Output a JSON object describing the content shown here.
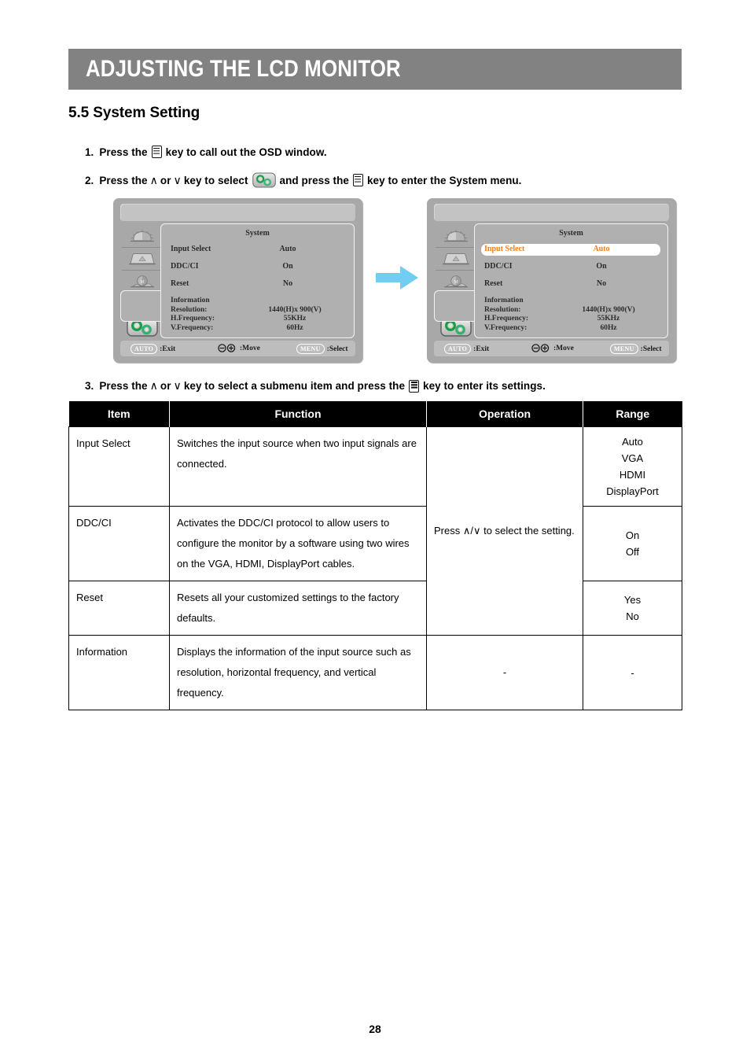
{
  "header": {
    "chapter_title": "ADJUSTING THE LCD MONITOR"
  },
  "section": {
    "heading": "5.5 System Setting"
  },
  "steps": [
    {
      "number": "1.",
      "text_before": "Press the",
      "icon": "menu-key-icon",
      "text_after": "key to call out the OSD window."
    },
    {
      "number": "2.",
      "part_a": "Press the",
      "up_glyph": "∧",
      "or_text": "or",
      "down_glyph": "∨",
      "part_b": "key to select",
      "icon": "system-gear-icon",
      "part_c": "and press the",
      "icon2": "menu-key-icon",
      "part_d": "key to enter the System menu."
    },
    {
      "number": "3.",
      "part_a": "Press the",
      "up_glyph": "∧",
      "or_text": "or",
      "down_glyph": "∨",
      "part_b": "key to select a submenu item and press the",
      "icon": "menu-key-icon",
      "part_c": "key to enter its settings."
    }
  ],
  "osd": {
    "menu_title": "System",
    "rail_icons": [
      "brightness-icon",
      "image-icon",
      "color-icon",
      "osd-icon",
      "system-gear-icon"
    ],
    "rows": [
      {
        "label": "Input Select",
        "value": "Auto"
      },
      {
        "label": "DDC/CI",
        "value": "On"
      },
      {
        "label": "Reset",
        "value": "No"
      }
    ],
    "information": {
      "title": "Information",
      "lines": [
        {
          "key": "Resolution:",
          "value": "1440(H)x 900(V)"
        },
        {
          "key": "H.Frequency:",
          "value": "55KHz"
        },
        {
          "key": "V.Frequency:",
          "value": "60Hz"
        }
      ]
    },
    "footer": {
      "exit_key": "AUTO",
      "exit_label": ":Exit",
      "move_label": ":Move",
      "select_key": "MENU",
      "select_label": ":Select"
    },
    "highlight_color": "#f08020",
    "highlight_row_index": 0
  },
  "arrow": {
    "name": "flow-arrow",
    "color": "#72cdf2"
  },
  "table": {
    "headers": [
      "Item",
      "Function",
      "Operation",
      "Range"
    ],
    "rows": [
      {
        "item": "Input Select",
        "function": "Switches the input source when two input signals are connected.",
        "operation": "",
        "range": [
          "Auto",
          "VGA",
          "HDMI",
          "DisplayPort"
        ]
      },
      {
        "item": "DDC/CI",
        "function": "Activates the DDC/CI protocol to allow users to configure the monitor by a software using two wires on the VGA, HDMI, DisplayPort cables.",
        "operation_prefix": "Press",
        "operation_up": "∧",
        "operation_slash": "/",
        "operation_down": "∨",
        "operation_suffix": "to select the setting.",
        "range": [
          "On",
          "Off"
        ]
      },
      {
        "item": "Reset",
        "function": "Resets all your customized settings to the factory defaults.",
        "operation": "",
        "range": [
          "Yes",
          "No"
        ]
      },
      {
        "item": "Information",
        "function": "Displays the information of the input source such as resolution, horizontal frequency, and vertical frequency.",
        "operation": "-",
        "range": [
          "-"
        ]
      }
    ]
  },
  "footer": {
    "page_number": "28"
  }
}
